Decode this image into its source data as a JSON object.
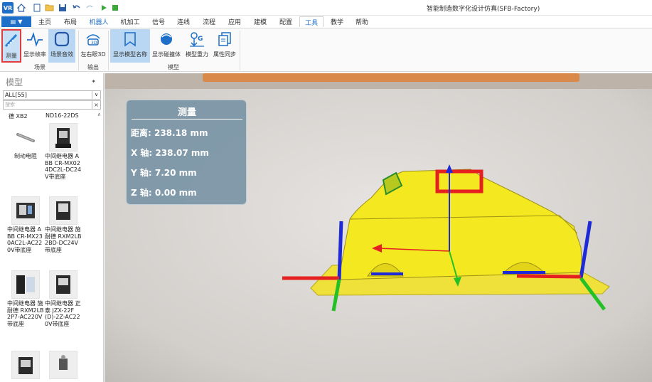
{
  "window": {
    "title": "智能制造数字化设计仿真(SFB-Factory)",
    "logo": "VR"
  },
  "menu": {
    "file_label": "▼",
    "tabs": [
      "主页",
      "布局",
      "机器人",
      "机加工",
      "信号",
      "连线",
      "流程",
      "应用",
      "建模",
      "配置",
      "工具",
      "教学",
      "帮助"
    ],
    "active_tab": "工具"
  },
  "ribbon": {
    "buttons": {
      "measure": "测量",
      "fps": "显示帧率",
      "scene_sound": "场景音效",
      "stereo": "左右眼3D",
      "model_name": "显示模型名称",
      "collision": "显示碰撞体",
      "gravity": "模型重力",
      "attr_sync": "属性同步"
    },
    "groups": {
      "scene": "场景",
      "output": "输出",
      "model": "模型"
    }
  },
  "panel": {
    "title": "模型",
    "filter": "ALL[55]",
    "search_placeholder": "搜索",
    "top_row": [
      "德 XB2",
      "ND16-22DS"
    ],
    "items": [
      "制动电阻",
      "中间继电器 ABB CR-MX024DC2L-DC24V带底座",
      "中间继电器 ABB CR-MX230AC2L-AC220V带底座",
      "中间继电器 施耐德 RXM2LB2BD-DC24V带底座",
      "中间继电器 施耐德 RXM2LB2P7-AC220V带底座",
      "中间继电器 正泰 JZX-22F(D)-2Z-AC220V带底座"
    ]
  },
  "measure": {
    "title": "测量",
    "distance": "距离: 238.18 mm",
    "x": "X 轴: 238.07 mm",
    "y": "Y 轴: 7.20 mm",
    "z": "Z 轴: 0.00 mm"
  },
  "colors": {
    "accent": "#1e6fc8",
    "highlight": "#e23b3b",
    "model": "#f2e41e",
    "overlay": "#6e8ca0"
  }
}
